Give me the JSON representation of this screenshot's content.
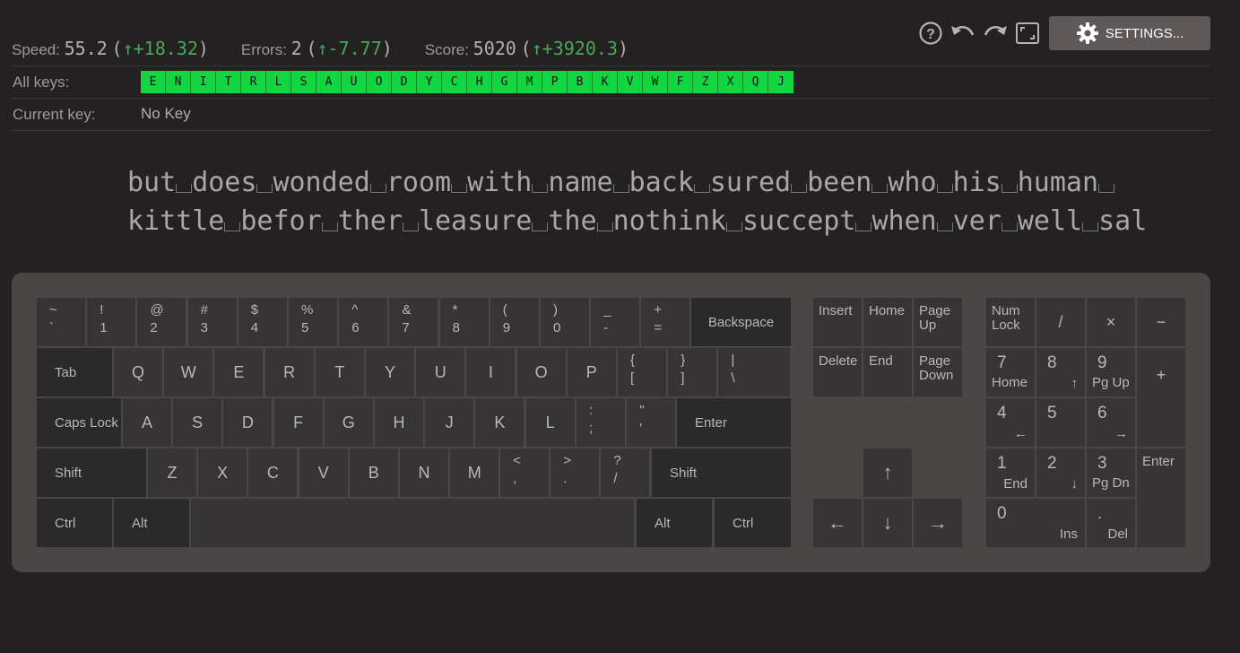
{
  "toolbar": {
    "help_icon": "help-circle-icon",
    "undo_icon": "undo-icon",
    "redo_icon": "redo-icon",
    "fullscreen_icon": "fullscreen-icon",
    "settings_label": "SETTINGS..."
  },
  "stats": {
    "speed": {
      "label": "Speed:",
      "value": "55.2",
      "open": "(",
      "delta": "↑+18.32",
      "close": ")"
    },
    "errors": {
      "label": "Errors:",
      "value": "2",
      "open": "(",
      "delta": "↑-7.77",
      "close": ")"
    },
    "score": {
      "label": "Score:",
      "value": "5020",
      "open": "(",
      "delta": "↑+3920.3",
      "close": ")"
    }
  },
  "all_keys": {
    "label": "All keys:",
    "keys": [
      "E",
      "N",
      "I",
      "T",
      "R",
      "L",
      "S",
      "A",
      "U",
      "O",
      "D",
      "Y",
      "C",
      "H",
      "G",
      "M",
      "P",
      "B",
      "K",
      "V",
      "W",
      "F",
      "Z",
      "X",
      "Q",
      "J"
    ]
  },
  "current_key": {
    "label": "Current key:",
    "value": "No Key"
  },
  "practice_text": {
    "lines": [
      [
        "but",
        "does",
        "wonded",
        "room",
        "with",
        "name",
        "back",
        "sured",
        "been",
        "who",
        "his",
        "human",
        ""
      ],
      [
        "kittle",
        "befor",
        "ther",
        "leasure",
        "the",
        "nothink",
        "succept",
        "when",
        "ver",
        "well",
        "sal"
      ]
    ]
  },
  "keyboard": {
    "row1": [
      {
        "shift": "~",
        "base": "`"
      },
      {
        "shift": "!",
        "base": "1"
      },
      {
        "shift": "@",
        "base": "2"
      },
      {
        "shift": "#",
        "base": "3"
      },
      {
        "shift": "$",
        "base": "4"
      },
      {
        "shift": "%",
        "base": "5"
      },
      {
        "shift": "^",
        "base": "6"
      },
      {
        "shift": "&",
        "base": "7"
      },
      {
        "shift": "*",
        "base": "8"
      },
      {
        "shift": "(",
        "base": "9"
      },
      {
        "shift": ")",
        "base": "0"
      },
      {
        "shift": "_",
        "base": "-"
      },
      {
        "shift": "+",
        "base": "="
      }
    ],
    "backspace": "Backspace",
    "tab": "Tab",
    "row2": [
      "Q",
      "W",
      "E",
      "R",
      "T",
      "Y",
      "U",
      "I",
      "O",
      "P"
    ],
    "row2_sym": [
      {
        "shift": "{",
        "base": "["
      },
      {
        "shift": "}",
        "base": "]"
      },
      {
        "shift": "|",
        "base": "\\"
      }
    ],
    "caps": "Caps Lock",
    "row3": [
      "A",
      "S",
      "D",
      "F",
      "G",
      "H",
      "J",
      "K",
      "L"
    ],
    "row3_sym": [
      {
        "shift": ":",
        "base": ";"
      },
      {
        "shift": "\"",
        "base": "'"
      }
    ],
    "enter": "Enter",
    "shift_left": "Shift",
    "row4": [
      "Z",
      "X",
      "C",
      "V",
      "B",
      "N",
      "M"
    ],
    "row4_sym": [
      {
        "shift": "<",
        "base": ","
      },
      {
        "shift": ">",
        "base": "."
      },
      {
        "shift": "?",
        "base": "/"
      }
    ],
    "shift_right": "Shift",
    "ctrl_left": "Ctrl",
    "alt_left": "Alt",
    "alt_right": "Alt",
    "ctrl_right": "Ctrl",
    "nav": {
      "insert": "Insert",
      "home": "Home",
      "pgup_1": "Page",
      "pgup_2": "Up",
      "delete": "Delete",
      "end": "End",
      "pgdn_1": "Page",
      "pgdn_2": "Down",
      "up": "↑",
      "left": "←",
      "down": "↓",
      "right": "→"
    },
    "numpad": {
      "numlock_1": "Num",
      "numlock_2": "Lock",
      "divide": "/",
      "multiply": "×",
      "minus": "−",
      "n7": "7",
      "n7_sub": "Home",
      "n8": "8",
      "n8_sub": "↑",
      "n9": "9",
      "n9_sub": "Pg Up",
      "plus": "+",
      "n4": "4",
      "n4_sub": "←",
      "n5": "5",
      "n6": "6",
      "n6_sub": "→",
      "n1": "1",
      "n1_sub": "End",
      "n2": "2",
      "n2_sub": "↓",
      "n3": "3",
      "n3_sub": "Pg Dn",
      "enter": "Enter",
      "n0": "0",
      "n0_sub": "Ins",
      "dot": ".",
      "dot_sub": "Del"
    }
  }
}
